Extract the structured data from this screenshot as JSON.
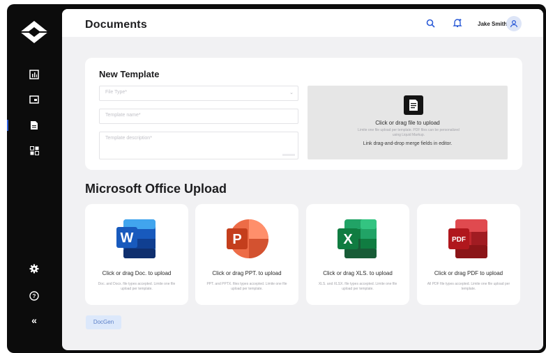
{
  "sidebar": {
    "logo": "app-logo",
    "nav_items": [
      "analytics-icon",
      "window-icon",
      "document-icon",
      "apps-grid-icon"
    ],
    "bottom_items": [
      "settings-icon",
      "help-icon",
      "collapse-icon"
    ],
    "collapse_glyph": "«",
    "active_color": "#2b5bd7"
  },
  "header": {
    "title": "Documents",
    "user_name": "Jake Smith",
    "accent": "#2b5bd7"
  },
  "new_template": {
    "title": "New Template",
    "file_type_placeholder": "File Type*",
    "template_name_placeholder": "Template name*",
    "template_description_placeholder": "Template description*",
    "dropzone": {
      "title": "Click or drag file to upload",
      "subtitle": "Limite one file upload per template. PDF files can be personalized using Liquid Markup.",
      "link_text": "Link drag-and-drop merge fields in editor."
    }
  },
  "office_upload": {
    "title": "Microsoft Office Upload",
    "cards": [
      {
        "icon": "word-icon",
        "letter": "W",
        "title": "Click or drag Doc. to upload",
        "subtitle": "Doc. and Docx. file types accepted. Limite one file upload per template."
      },
      {
        "icon": "powerpoint-icon",
        "letter": "P",
        "title": "Click or drag PPT. to upload",
        "subtitle": "PPT. and PPTX. files types accepted. Limite one file upload per template."
      },
      {
        "icon": "excel-icon",
        "letter": "X",
        "title": "Click or drag XLS. to upload",
        "subtitle": "XLS. and XLSX. file types accepted. Limite one file upload per template."
      },
      {
        "icon": "pdf-icon",
        "letter": "PDF",
        "title": "Click or drag PDF to upload",
        "subtitle": "All PDF file types accepted. Limite one file upload per template."
      }
    ]
  },
  "footer": {
    "badge": "DocGen"
  }
}
